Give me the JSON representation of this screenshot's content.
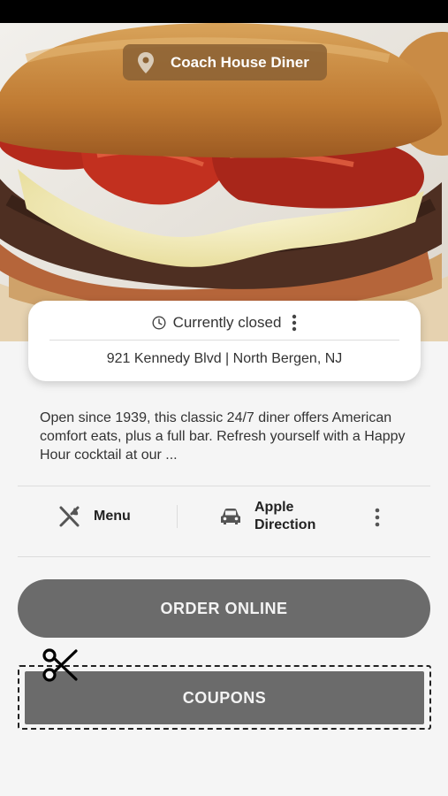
{
  "restaurant": {
    "name": "Coach House Diner",
    "status": "Currently closed",
    "address": "921 Kennedy Blvd  | North Bergen, NJ",
    "description": "Open since 1939, this classic 24/7 diner offers American comfort eats, plus a full bar. Refresh yourself with a Happy Hour cocktail at our ..."
  },
  "actions": {
    "menu_label": "Menu",
    "direction_label": "Apple Direction"
  },
  "buttons": {
    "order_online": "ORDER ONLINE",
    "coupons": "COUPONS"
  },
  "icons": {
    "location": "location-pin-icon",
    "clock": "clock-icon",
    "more": "kebab-menu-icon",
    "menu": "fork-knife-icon",
    "car": "car-icon",
    "scissors": "scissors-icon"
  },
  "colors": {
    "button_gray": "#6b6b6b",
    "pill_brown": "#8c6234",
    "background": "#f5f5f5"
  }
}
